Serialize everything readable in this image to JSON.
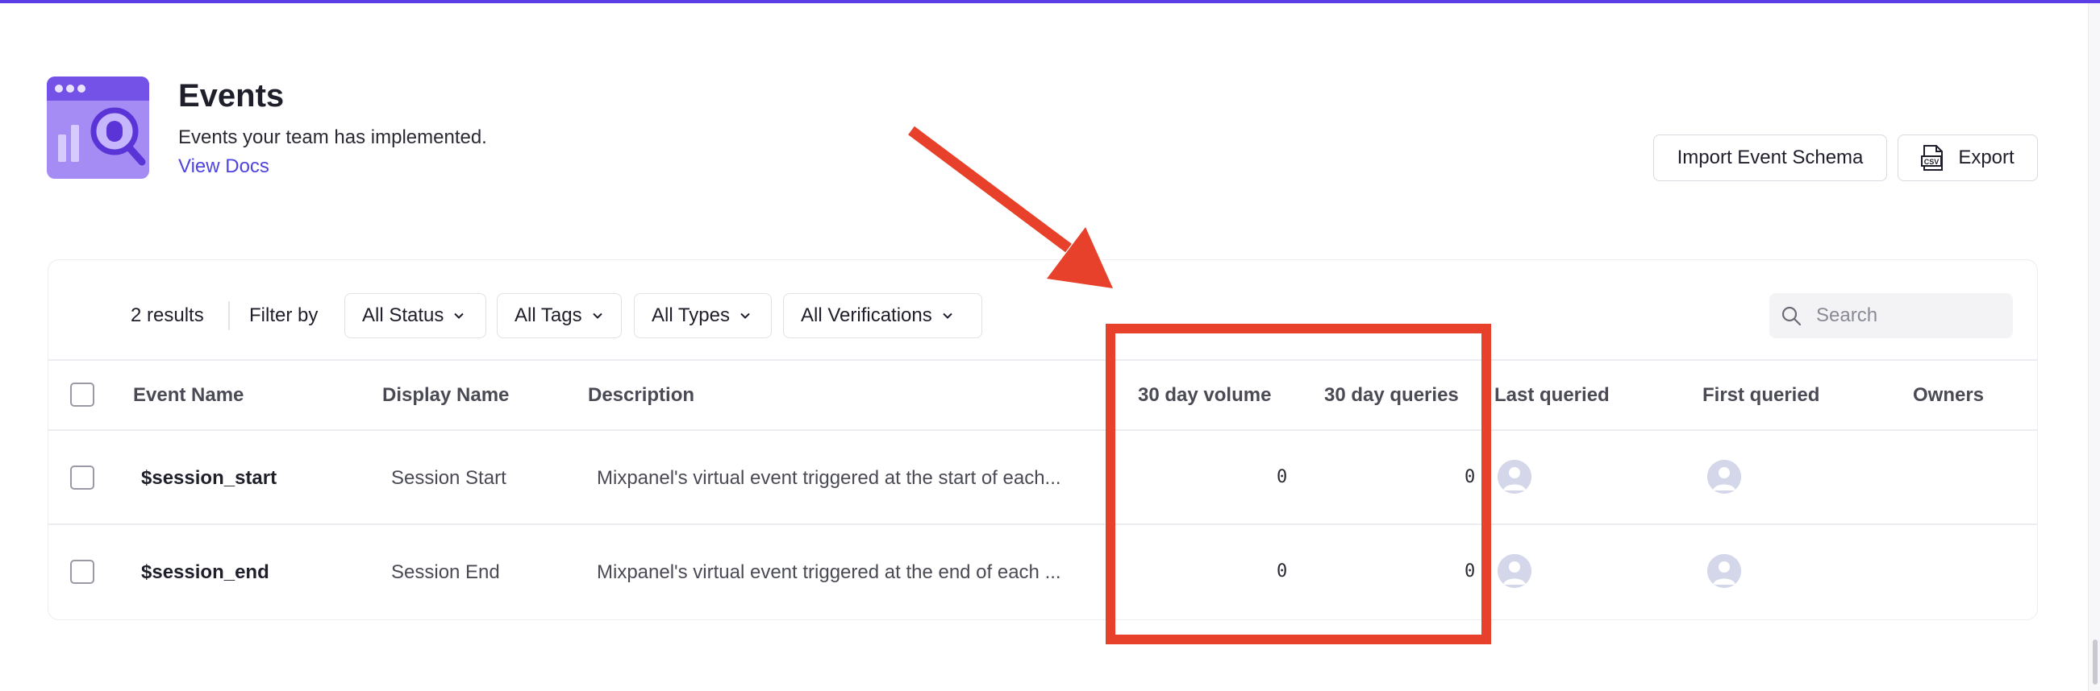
{
  "header": {
    "title": "Events",
    "subtitle": "Events your team has implemented.",
    "docs_link": "View Docs"
  },
  "actions": {
    "import_label": "Import Event Schema",
    "export_label": "Export",
    "export_icon": "csv-file-icon"
  },
  "toolbar": {
    "results": "2 results",
    "filter_label": "Filter by",
    "filters": [
      "All Status",
      "All Tags",
      "All Types",
      "All Verifications"
    ],
    "search_placeholder": "Search"
  },
  "table": {
    "columns": [
      "Event Name",
      "Display Name",
      "Description",
      "30 day volume",
      "30 day queries",
      "Last queried",
      "First queried",
      "Owners"
    ],
    "rows": [
      {
        "event_name": "$session_start",
        "display_name": "Session Start",
        "description": "Mixpanel's virtual event triggered at the start of each...",
        "volume": "0",
        "queries": "0",
        "last_queried_icon": "user-avatar-icon",
        "first_queried_icon": "user-avatar-icon"
      },
      {
        "event_name": "$session_end",
        "display_name": "Session End",
        "description": "Mixpanel's virtual event triggered at the end of each ...",
        "volume": "0",
        "queries": "0",
        "last_queried_icon": "user-avatar-icon",
        "first_queried_icon": "user-avatar-icon"
      }
    ]
  },
  "colors": {
    "accent": "#5b3ee6",
    "link": "#4f44e0",
    "annotation": "#e8412b"
  }
}
